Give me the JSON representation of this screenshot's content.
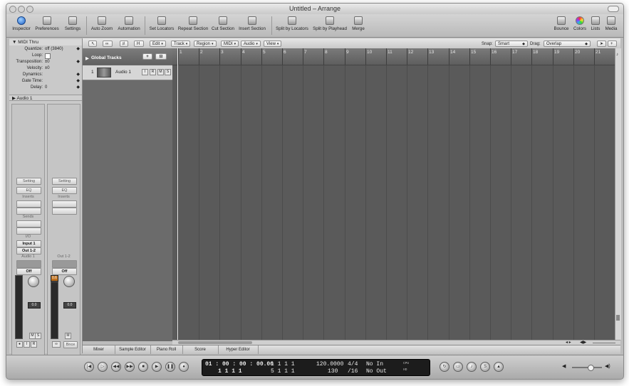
{
  "window": {
    "title": "Untitled – Arrange"
  },
  "toolbar": {
    "inspector": "Inspector",
    "preferences": "Preferences",
    "settings": "Settings",
    "auto_zoom": "Auto Zoom",
    "automation": "Automation",
    "set_locators": "Set Locators",
    "repeat_section": "Repeat Section",
    "cut_section": "Cut Section",
    "insert_section": "Insert Section",
    "split_by_locators": "Split by Locators",
    "split_by_playhead": "Split by Playhead",
    "merge": "Merge",
    "bounce": "Bounce",
    "colors": "Colors",
    "lists": "Lists",
    "media": "Media"
  },
  "inspector": {
    "header": "MIDI Thru",
    "params": [
      {
        "label": "Quantize:",
        "value": "off (3840)"
      },
      {
        "label": "Loop:",
        "value": ""
      },
      {
        "label": "Transposition:",
        "value": "±0"
      },
      {
        "label": "Velocity:",
        "value": "±0"
      },
      {
        "label": "Dynamics:",
        "value": ""
      },
      {
        "label": "Gate Time:",
        "value": ""
      },
      {
        "label": "Delay:",
        "value": "0"
      }
    ],
    "track_section": "Audio 1",
    "strip1": {
      "setting": "Setting",
      "eq": "EQ",
      "inserts": "Inserts",
      "sends": "Sends",
      "io": "I/O",
      "input": "Input 1",
      "output": "Out 1-2",
      "name": "Audio 1",
      "automation": "Off",
      "volume": "0.0"
    },
    "strip2": {
      "setting": "Setting",
      "eq": "EQ",
      "inserts": "Inserts",
      "name": "Out 1-2",
      "automation": "Off",
      "volume": "0.0",
      "peak": "0.6",
      "bounce": "Bnce"
    }
  },
  "local_menus": {
    "edit": "Edit",
    "track": "Track",
    "region": "Region",
    "midi": "MIDI",
    "audio": "Audio",
    "view": "View",
    "snap_label": "Snap:",
    "snap_value": "Smart",
    "drag_label": "Drag:",
    "drag_value": "Overlap",
    "h_button": "H"
  },
  "tracks": {
    "global_tracks": "Global Tracks",
    "list": [
      {
        "number": "1",
        "name": "Audio 1",
        "buttons": [
          "I",
          "R",
          "M",
          "S"
        ]
      }
    ]
  },
  "ruler": {
    "bars": [
      "1",
      "2",
      "3",
      "4",
      "5",
      "6",
      "7",
      "8",
      "9",
      "10",
      "11",
      "12",
      "13",
      "14",
      "15",
      "16",
      "17",
      "18",
      "19",
      "20",
      "21",
      "22"
    ]
  },
  "tabs": [
    "Mixer",
    "Sample Editor",
    "Piano Roll",
    "Score",
    "Hyper Editor"
  ],
  "transport": {
    "smpte": "01 : 00 : 00 : 00.00",
    "bars_top": "1    1    1    1",
    "bars_mid": "1    1    1    1",
    "bars_bottom_left": "1    1    1    1",
    "bars_bottom_right": "5    1    1    1",
    "tempo": "120.0000",
    "division": "130",
    "signature": "4/4",
    "subdiv": "/16",
    "midi_in": "No In",
    "midi_out": "No Out",
    "cpu": "CPU",
    "hd": "HD"
  }
}
